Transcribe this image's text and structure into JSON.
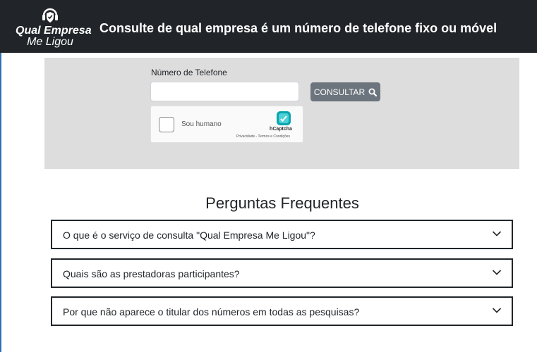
{
  "header": {
    "logo_line1": "Qual Empresa",
    "logo_line2": "Me Ligou",
    "title": "Consulte de qual empresa é um número de telefone fixo ou móvel"
  },
  "form": {
    "phone_label": "Número de Telefone",
    "phone_value": "",
    "consult_label": "CONSULTAR"
  },
  "captcha": {
    "checkbox_label": "Sou humano",
    "brand": "hCaptcha",
    "links": "Privacidade - Termos e Condições"
  },
  "faq": {
    "title": "Perguntas Frequentes",
    "items": [
      {
        "question": "O que é o serviço de consulta \"Qual Empresa Me Ligou\"?"
      },
      {
        "question": "Quais são as prestadoras participantes?"
      },
      {
        "question": "Por que não aparece o titular dos números em todas as pesquisas?"
      }
    ]
  },
  "colors": {
    "header_bg": "#212529",
    "panel_bg": "#dddddd",
    "button_bg": "#6c757d",
    "captcha_accent": "#0aa5ae"
  }
}
